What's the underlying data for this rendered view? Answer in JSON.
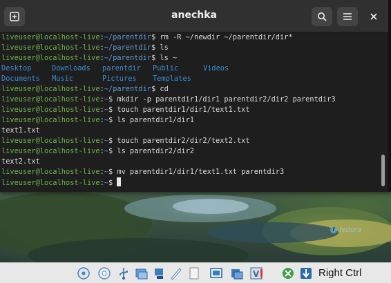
{
  "window": {
    "title": "anechka"
  },
  "toolbar": {
    "new_tab": "new-tab-icon",
    "search": "search-icon",
    "menu": "hamburger-menu-icon",
    "close": "close-icon"
  },
  "terminal": {
    "prompt_user": "liveuser@localhost-live",
    "lines": [
      {
        "type": "cmd",
        "path": "~/parentdir",
        "cmd": "rm -R ~/newdir ~/parentdir/dir*"
      },
      {
        "type": "cmd",
        "path": "~/parentdir",
        "cmd": "ls"
      },
      {
        "type": "cmd",
        "path": "~/parentdir",
        "cmd": "ls ~"
      },
      {
        "type": "dirs",
        "items": [
          "Desktop",
          "Downloads",
          "parentdir",
          "Public",
          "Videos"
        ]
      },
      {
        "type": "dirs",
        "items": [
          "Documents",
          "Music",
          "Pictures",
          "Templates"
        ]
      },
      {
        "type": "cmd",
        "path": "~/parentdir",
        "cmd": "cd"
      },
      {
        "type": "cmd",
        "path": "~",
        "cmd": "mkdir -p parentdir1/dir1 parentdir2/dir2 parentdir3"
      },
      {
        "type": "cmd",
        "path": "~",
        "cmd": "touch parentdir1/dir1/text1.txt"
      },
      {
        "type": "cmd",
        "path": "~",
        "cmd": "ls parentdir1/dir1"
      },
      {
        "type": "out",
        "text": "text1.txt"
      },
      {
        "type": "cmd",
        "path": "~",
        "cmd": "touch parentdir2/dir2/text2.txt"
      },
      {
        "type": "cmd",
        "path": "~",
        "cmd": "ls parentdir2/dir2"
      },
      {
        "type": "out",
        "text": "text2.txt"
      },
      {
        "type": "cmd",
        "path": "~",
        "cmd": "mv parentdir1/dir1/text1.txt parentdir3"
      },
      {
        "type": "cmd",
        "path": "~",
        "cmd": "",
        "cursor": true
      }
    ]
  },
  "desktop": {
    "logo_text": "fedora"
  },
  "statusbar": {
    "icons": [
      "hard-disk-icon",
      "optical-drive-icon",
      "usb-icon",
      "shared-folders-icon",
      "network-icon",
      "display-icon",
      "capture-icon",
      "recording-icon",
      "virtualization-icon",
      "mouse-integration-icon",
      "keyboard-capture-icon"
    ],
    "host_key": "Right Ctrl"
  },
  "colors": {
    "prompt": "#6fb54a",
    "path": "#5e9ad6",
    "directory": "#3b8ed6",
    "terminal_bg": "#1e1e1e"
  }
}
